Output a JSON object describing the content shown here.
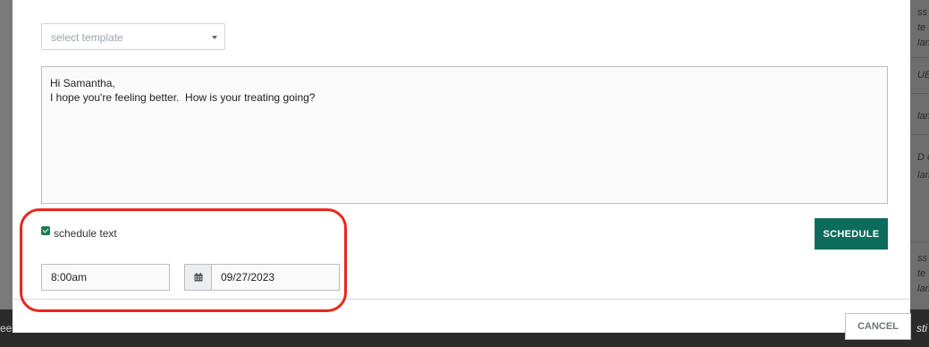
{
  "background": {
    "right_fragments": [
      "ss",
      "te",
      "lan",
      "UB",
      "lan",
      "D c",
      "lan",
      "ss",
      "te",
      "lan"
    ],
    "bottom_left_fragment": "ee",
    "bottom_right_fragment": "sti"
  },
  "modal": {
    "template_select": {
      "placeholder": "select template"
    },
    "message_text": "Hi Samantha,\nI hope you're feeling better.  How is your treating going?",
    "schedule_checkbox": {
      "label": "schedule text",
      "checked": true
    },
    "schedule_button_label": "SCHEDULE",
    "time_value": "8:00am",
    "date_value": "09/27/2023",
    "cancel_button_label": "CANCEL"
  },
  "colors": {
    "accent": "#0d6b5c",
    "checkbox": "#1e7a54",
    "highlight": "#e8281c"
  },
  "icons": {
    "calendar": "calendar-icon",
    "dropdown": "chevron-down-icon"
  }
}
